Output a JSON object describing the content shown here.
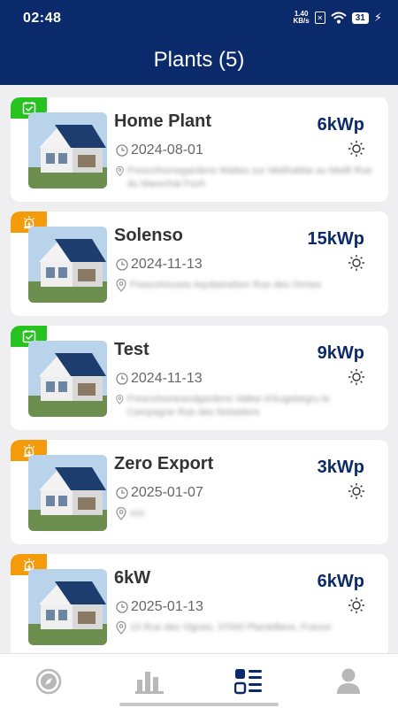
{
  "status_bar": {
    "time": "02:48",
    "net_speed_value": "1.40",
    "net_speed_unit": "KB/s",
    "battery": "31"
  },
  "header": {
    "title": "Plants (5)"
  },
  "plants": [
    {
      "name": "Home Plant",
      "date": "2024-08-01",
      "address": "Frescohomegardens Wattes sur Meilhabbe au Meilli Rue du Marechal Foch",
      "power": "6kWp",
      "status": "ok"
    },
    {
      "name": "Solenso",
      "date": "2024-11-13",
      "address": "Frescohouses Aquitainebon Rue des Ormes",
      "power": "15kWp",
      "status": "alarm"
    },
    {
      "name": "Test",
      "date": "2024-11-13",
      "address": "Frescohomeandgardens Vallee d'Augebegru le Campagne Rue des Noisetiers",
      "power": "9kWp",
      "status": "ok"
    },
    {
      "name": "Zero Export",
      "date": "2025-01-07",
      "address": "xxx",
      "power": "3kWp",
      "status": "alarm"
    },
    {
      "name": "6kW",
      "date": "2025-01-13",
      "address": "10 Rue des Vignes, 37000 Plantelliere, France",
      "power": "6kWp",
      "status": "alarm"
    }
  ],
  "bottom_nav": [
    {
      "name": "compass-icon",
      "active": false
    },
    {
      "name": "bar-chart-icon",
      "active": false
    },
    {
      "name": "list-icon",
      "active": true
    },
    {
      "name": "user-icon",
      "active": false
    }
  ],
  "colors": {
    "header": "#0b2a6b",
    "ok_badge": "#26c21f",
    "alarm_badge": "#f49b0b",
    "power_text": "#0b2a6b"
  }
}
